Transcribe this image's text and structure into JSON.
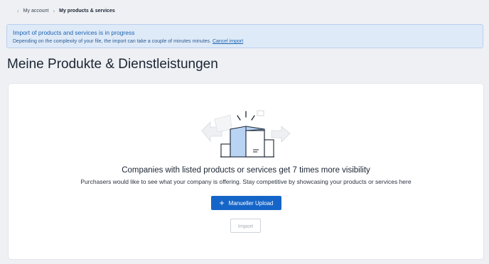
{
  "breadcrumb": {
    "items": [
      "My account",
      "My products & services"
    ]
  },
  "banner": {
    "title": "Import of products and services is in progress",
    "text": "Depending on the complexity of your file, the import can take a couple of minutes minutes.",
    "link": "Cancel import"
  },
  "page": {
    "title": "Meine Produkte & Dienstleistungen"
  },
  "empty_state": {
    "illustration": "warehouse-boxes-icon",
    "headline": "Companies with listed products or services get 7 times more visibility",
    "subline": "Purchasers would like to see what your company is offering. Stay competitive by showcasing your products or services here",
    "upload_button": "Manueller Upload",
    "upload_icon": "plus-icon",
    "import_button": "Import"
  },
  "colors": {
    "accent": "#1565c8",
    "banner_bg": "#dfeaf8",
    "banner_text": "#1c64b0",
    "page_bg": "#eef0f3"
  }
}
